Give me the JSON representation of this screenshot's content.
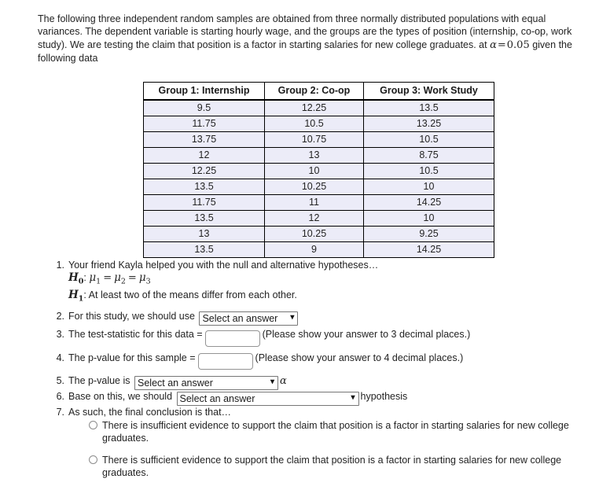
{
  "intro": {
    "line1": "The following three independent random samples are obtained from three normally distributed populations",
    "line2": "with equal variances.  The dependent variable is starting hourly wage, and the groups are the types of",
    "line3": "position (internship, co-op, work study). We are testing the claim that position is a factor in starting",
    "line4_pre": "salaries for new college graduates. at ",
    "alpha_symbol": "α",
    "equals": "=",
    "alpha_value": "0.05",
    "line4_post": " given the following data"
  },
  "table": {
    "headers": [
      "Group 1: Internship",
      "Group 2: Co-op",
      "Group 3: Work Study"
    ],
    "rows": [
      [
        "9.5",
        "12.25",
        "13.5"
      ],
      [
        "11.75",
        "10.5",
        "13.25"
      ],
      [
        "13.75",
        "10.75",
        "10.5"
      ],
      [
        "12",
        "13",
        "8.75"
      ],
      [
        "12.25",
        "10",
        "10.5"
      ],
      [
        "13.5",
        "10.25",
        "10"
      ],
      [
        "11.75",
        "11",
        "14.25"
      ],
      [
        "13.5",
        "12",
        "10"
      ],
      [
        "13",
        "10.25",
        "9.25"
      ],
      [
        "13.5",
        "9",
        "14.25"
      ]
    ]
  },
  "questions": {
    "q1": {
      "num": "1.",
      "text": "Your friend Kayla helped you with the null and alternative hypotheses…",
      "h0_label": "H",
      "h0_sub": "0",
      "h0_colon": ":",
      "mu": "μ",
      "mu1_sub": "1",
      "mu2_sub": "2",
      "mu3_sub": "3",
      "eq": "=",
      "h1_label": "H",
      "h1_sub": "1",
      "h1_colon": ":",
      "h1_text": "At least two of the means differ from each other."
    },
    "q2": {
      "num": "2.",
      "text": "For this study, we should use",
      "select_value": "Select an answer",
      "chevron": "⌄"
    },
    "q3": {
      "num": "3.",
      "text": "The test-statistic for this data =",
      "input_value": "",
      "note": "(Please show your answer to 3 decimal places.)"
    },
    "q4": {
      "num": "4.",
      "text": "The p-value for this sample =",
      "input_value": "",
      "note": "(Please show your answer to 4 decimal places.)"
    },
    "q5": {
      "num": "5.",
      "text": "The p-value is",
      "select_value": "Select an answer",
      "alpha_symbol": "α"
    },
    "q6": {
      "num": "6.",
      "text": "Base on this, we should",
      "select_value": "Select an answer",
      "suffix": "hypothesis"
    },
    "q7": {
      "num": "7.",
      "text": "As such, the final conclusion is that…"
    }
  },
  "choices": [
    {
      "text": "There is insufficient evidence to support the claim that position is a factor in starting salaries for new college graduates.",
      "selected": false
    },
    {
      "text": "There is sufficient evidence to support the claim that position is a factor in starting salaries for new college graduates.",
      "selected": false
    }
  ],
  "colors": {
    "table_cell_bg": "#ececf8",
    "table_border": "#000000",
    "text": "#232323",
    "input_border": "#949494"
  }
}
